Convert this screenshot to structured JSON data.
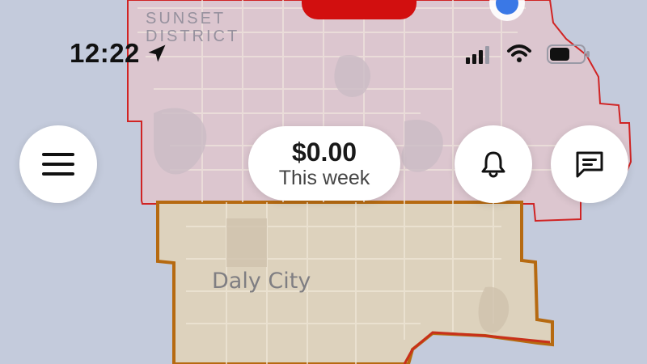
{
  "map": {
    "district_label": "SUNSET DISTRICT",
    "city_label": "Daly City",
    "zone_colors": {
      "red_zone_fill": "#dcc6cf",
      "red_zone_border": "#d02424",
      "orange_zone_fill": "#ddd2bd",
      "orange_zone_border": "#b66a11"
    }
  },
  "status_bar": {
    "time": "12:22",
    "icons": [
      "location-arrow-icon",
      "cellular-signal-icon",
      "wifi-icon",
      "battery-icon"
    ]
  },
  "earnings": {
    "amount": "$0.00",
    "period": "This week"
  },
  "buttons": {
    "menu_icon": "hamburger-menu-icon",
    "notifications_icon": "bell-icon",
    "messages_icon": "chat-bubble-icon"
  },
  "colors": {
    "accent_red": "#d20f0f",
    "location_blue": "#3a78e6"
  }
}
